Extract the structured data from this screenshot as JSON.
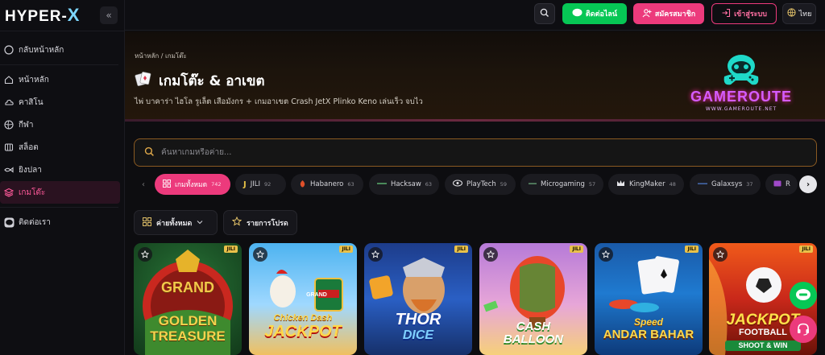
{
  "brand": {
    "name_main": "HYPER-",
    "name_x": "X"
  },
  "sidebar": {
    "collapse_icon": "«",
    "items": [
      {
        "label": "กลับหน้าหลัก",
        "icon": "circle-icon"
      },
      {
        "label": "หน้าหลัก",
        "icon": "home-icon"
      },
      {
        "label": "คาสิโน",
        "icon": "cloud-icon"
      },
      {
        "label": "กีฬา",
        "icon": "ball-icon"
      },
      {
        "label": "สล็อต",
        "icon": "slot-icon"
      },
      {
        "label": "ยิงปลา",
        "icon": "fish-icon"
      },
      {
        "label": "เกมโต๊ะ",
        "icon": "layers-icon",
        "active": true
      },
      {
        "label": "ติดต่อเรา",
        "icon": "line-icon"
      }
    ]
  },
  "topbar": {
    "line_label": "ติดต่อไลน์",
    "signup_label": "สมัครสมาชิก",
    "login_label": "เข้าสู่ระบบ",
    "lang_label": "ไทย"
  },
  "hero": {
    "breadcrumb": "หน้าหลัก / เกมโต๊ะ",
    "title": "เกมโต๊ะ & อาเขต",
    "description": "ไพ่ บาคาร่า ไฮโล รูเล็ต เสือมังกร + เกมอาเขต Crash JetX Plinko Keno เล่นเร็ว จบไว",
    "logo_text": "GAMEROUTE",
    "logo_url": "WWW.GAMEROUTE.NET"
  },
  "search": {
    "placeholder": "ค้นหาเกมหรือค่าย..."
  },
  "providers": [
    {
      "name": "เกมทั้งหมด",
      "count": "742",
      "active": true
    },
    {
      "name": "JILI",
      "count": "92"
    },
    {
      "name": "Habanero",
      "count": "63"
    },
    {
      "name": "Hacksaw",
      "count": "63"
    },
    {
      "name": "PlayTech",
      "count": "59"
    },
    {
      "name": "Microgaming",
      "count": "57"
    },
    {
      "name": "KingMaker",
      "count": "48"
    },
    {
      "name": "Galaxsys",
      "count": "37"
    },
    {
      "name": "R",
      "count": ""
    }
  ],
  "filters": {
    "all_providers": "ค่ายทั้งหมด",
    "favorites": "รายการโปรด"
  },
  "games": [
    {
      "title_line1": "GRAND",
      "title_line2": "GOLDEN",
      "title_line3": "TREASURE",
      "provider": "JILI"
    },
    {
      "title_line1": "Chicken Dash",
      "title_line2": "JACKPOT",
      "title_line3": "",
      "sign": "GRAND",
      "provider": "JILI"
    },
    {
      "title_line1": "THOR",
      "title_line2": "DICE",
      "title_line3": "",
      "provider": "JILI"
    },
    {
      "title_line1": "CASH",
      "title_line2": "BALLOON",
      "title_line3": "",
      "provider": "JILI"
    },
    {
      "title_line1": "Speed",
      "title_line2": "ANDAR BAHAR",
      "title_line3": "",
      "provider": "JILI"
    },
    {
      "title_line1": "JACKPOT",
      "title_line2": "FOOTBALL",
      "title_line3": "SHOOT & WIN",
      "provider": "JILI"
    }
  ],
  "colors": {
    "accent": "#ec3a7c",
    "line_green": "#06c755",
    "gold_border": "#8a5a22"
  }
}
